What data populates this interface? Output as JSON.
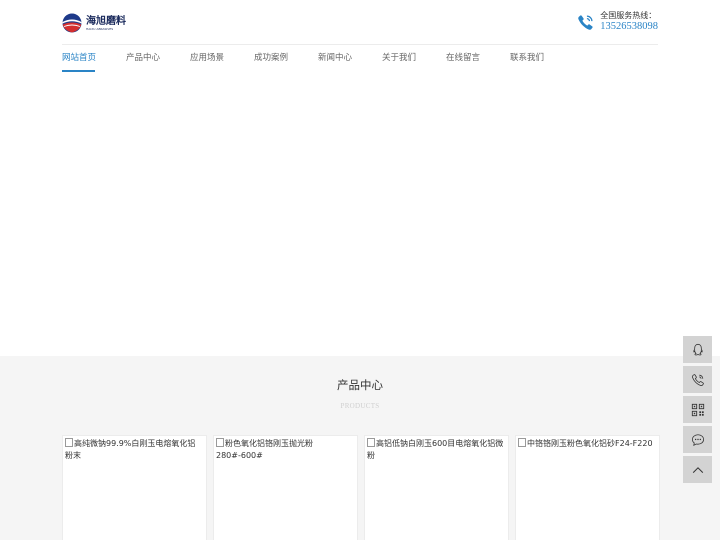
{
  "header": {
    "logo_cn": "海旭磨料",
    "logo_en": "HAIXU ABRASIVES",
    "hotline_label": "全国服务热线：",
    "hotline_number": "13526538098"
  },
  "nav": {
    "items": [
      {
        "label": "网站首页",
        "active": true
      },
      {
        "label": "产品中心"
      },
      {
        "label": "应用场景"
      },
      {
        "label": "成功案例"
      },
      {
        "label": "新闻中心"
      },
      {
        "label": "关于我们"
      },
      {
        "label": "在线留言"
      },
      {
        "label": "联系我们"
      }
    ]
  },
  "products": {
    "title": "产品中心",
    "subtitle": "PRODUCTS",
    "cards": [
      {
        "alt": "高纯微钠99.9%白刚玉电熔氧化铝粉末"
      },
      {
        "alt": "粉色氧化铝铬刚玉抛光粉280#-600#"
      },
      {
        "alt": "高铝低钠白刚玉600目电熔氧化铝微粉"
      },
      {
        "alt": "中铬铬刚玉粉色氧化铝砂F24-F220"
      }
    ]
  },
  "float_bar": {
    "buttons": [
      "qq-icon",
      "phone-icon",
      "qrcode-icon",
      "message-icon",
      "back-to-top-icon"
    ]
  },
  "colors": {
    "accent": "#2a84c6",
    "float_button": "#d3d3d3",
    "section_bg": "#f5f5f5"
  }
}
